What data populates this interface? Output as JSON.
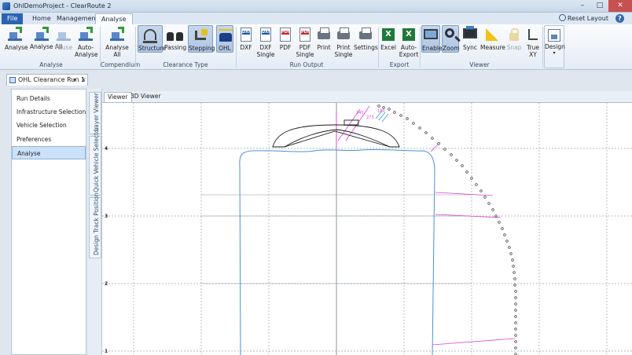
{
  "window": {
    "title": "OhlDemoProject - ClearRoute 2",
    "minimize": "–",
    "maximize": "□",
    "close": "✕"
  },
  "ribbon_tabs": [
    "File",
    "Home",
    "Management",
    "Analyse"
  ],
  "ribbon_right": {
    "reset_layout": "Reset Layout",
    "help": "?"
  },
  "ribbon": {
    "analyse_group": {
      "label": "Analyse",
      "buttons": [
        "Analyse",
        "Analyse All",
        "Pause",
        "Auto-Analyse"
      ]
    },
    "compendium_group": {
      "label": "Compendium",
      "buttons": [
        "Analyse All"
      ]
    },
    "clearance_type_group": {
      "label": "Clearance Type",
      "buttons": [
        "Structure",
        "Passing",
        "Stepping",
        "OHL"
      ]
    },
    "run_output_group": {
      "label": "Run Output",
      "buttons": [
        "DXF",
        "DXF Single",
        "PDF",
        "PDF Single",
        "Print",
        "Print Single",
        "Settings"
      ]
    },
    "export_group": {
      "label": "Export",
      "buttons": [
        "Excel",
        "Auto-Export"
      ]
    },
    "viewer_group": {
      "label": "Viewer",
      "buttons": [
        "Enable",
        "Zoom",
        "Sync",
        "Measure",
        "Snap",
        "True XY"
      ]
    },
    "design": "Design",
    "icon_text": {
      "dxf": "DXF",
      "pdf": "PDF"
    }
  },
  "document_tab": {
    "title": "OHL Clearance Run 1",
    "pin": "▾",
    "close": "×"
  },
  "left_nav": [
    "Run Details",
    "Infrastructure Selection",
    "Vehicle Selection",
    "Preferences",
    "Analyse"
  ],
  "side_tabs": [
    "Layer Viewer",
    "Quick Vehicle Selector",
    "Design Track Position"
  ],
  "viewer_tabs": [
    "Viewer",
    "3D Viewer"
  ],
  "axis_labels": [
    "4",
    "3",
    "2",
    "1"
  ],
  "annotations": [
    "345",
    "273",
    "180"
  ],
  "colors": {
    "file_tab": "#2b63b3",
    "gauge_outline": "#4a90d9",
    "clearance_lines": "#e040d0",
    "grid": "#9aa4b0"
  }
}
